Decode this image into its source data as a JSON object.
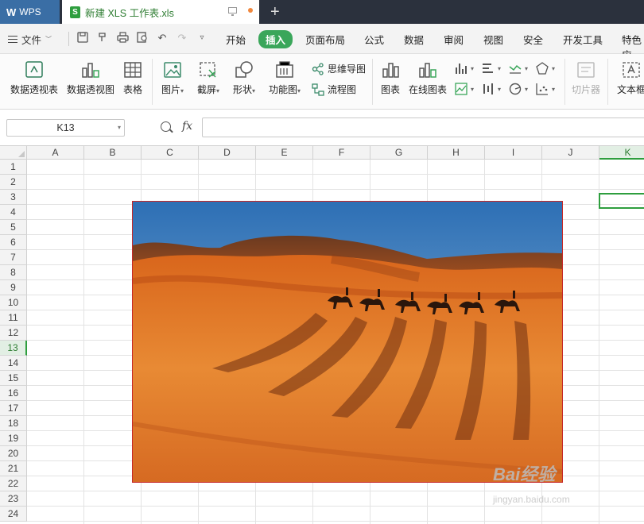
{
  "titlebar": {
    "app_tab": "WPS",
    "doc_tab": "新建 XLS 工作表.xls",
    "new_tab": "+"
  },
  "menu": {
    "file": "文件",
    "items": [
      "开始",
      "插入",
      "页面布局",
      "公式",
      "数据",
      "审阅",
      "视图",
      "安全",
      "开发工具",
      "特色应"
    ],
    "active_item": "插入"
  },
  "ribbon": {
    "pivot_table": "数据透视表",
    "pivot_chart": "数据透视图",
    "table": "表格",
    "picture": "图片",
    "screenshot": "截屏",
    "shape": "形状",
    "function_chart": "功能图",
    "mindmap": "思维导图",
    "flowchart": "流程图",
    "chart": "图表",
    "online_chart": "在线图表",
    "slicer": "切片器",
    "textbox": "文本框"
  },
  "formula_bar": {
    "name_box": "K13",
    "fx_label": "fx",
    "formula": ""
  },
  "grid": {
    "columns": [
      "A",
      "B",
      "C",
      "D",
      "E",
      "F",
      "G",
      "H",
      "I",
      "J",
      "K"
    ],
    "rows": [
      "1",
      "2",
      "3",
      "4",
      "5",
      "6",
      "7",
      "8",
      "9",
      "10",
      "11",
      "12",
      "13",
      "14",
      "15",
      "16",
      "17",
      "18",
      "19",
      "20",
      "21",
      "22",
      "23",
      "24"
    ],
    "active_column": "K",
    "active_row": "13"
  },
  "watermark": {
    "brand": "Bai经验",
    "url": "jingyan.baidu.com"
  },
  "colors": {
    "accent": "#2e9e3e",
    "titlebar": "#2b313d",
    "wps_tab": "#3a6ea5"
  }
}
